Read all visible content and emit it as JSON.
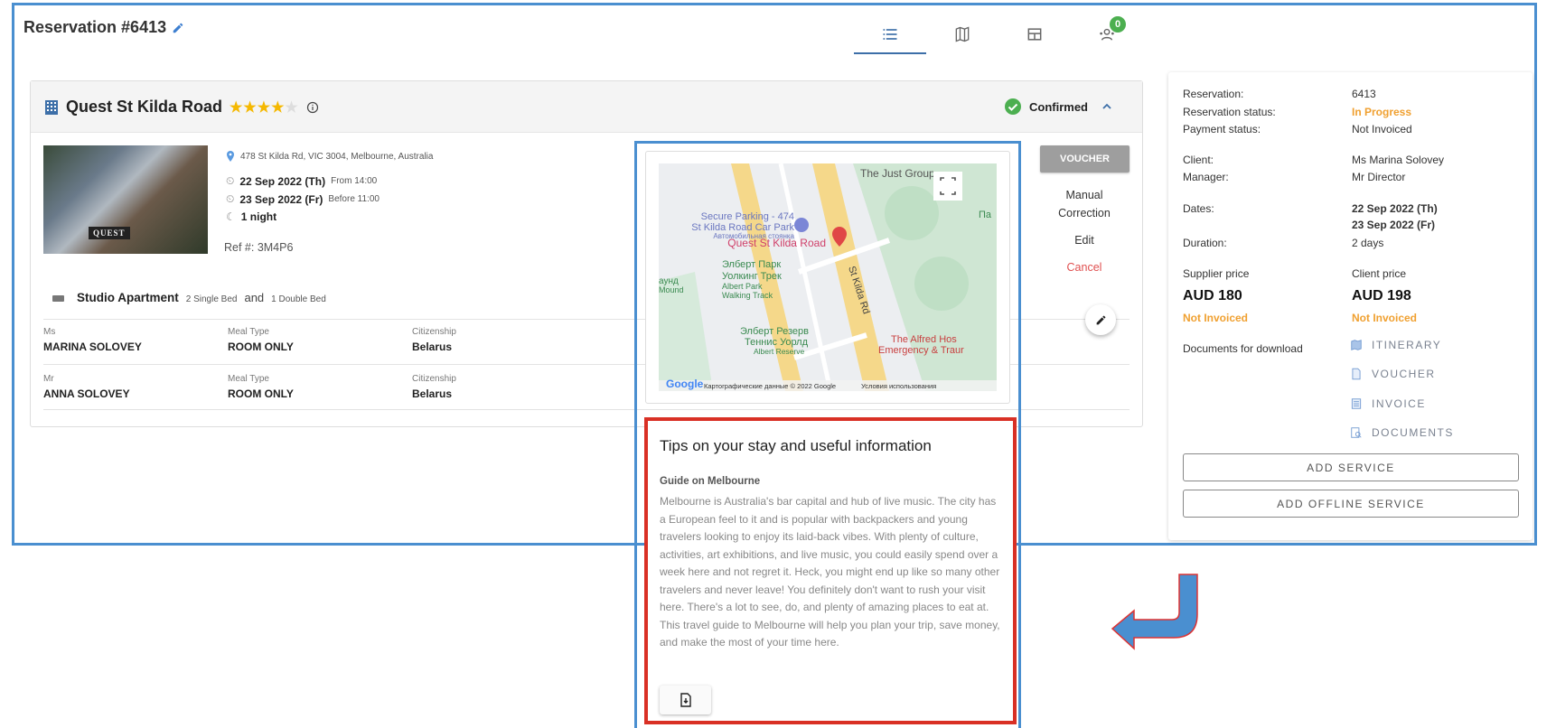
{
  "header": {
    "title": "Reservation #6413",
    "tabs": [
      {
        "icon": "list-icon",
        "active": true
      },
      {
        "icon": "map-icon"
      },
      {
        "icon": "table-icon"
      },
      {
        "icon": "group-icon",
        "badge": "0"
      }
    ]
  },
  "hotel": {
    "name": "Quest St Kilda Road",
    "stars": 4,
    "max_stars": 5,
    "status": "Confirmed",
    "address": "478 St Kilda Rd, VIC 3004, Melbourne, Australia",
    "checkin_date": "22 Sep 2022 (Th)",
    "checkin_time": "From 14:00",
    "checkout_date": "23 Sep 2022 (Fr)",
    "checkout_time": "Before 11:00",
    "nights": "1 night",
    "ref": "Ref #: 3M4P6",
    "photo_sign": "QUEST",
    "room": {
      "name": "Studio Apartment",
      "bed1": "2 Single Bed",
      "and": "and",
      "bed2": "1 Double Bed"
    },
    "guests": [
      {
        "title": "Ms",
        "name": "MARINA SOLOVEY",
        "meal_label": "Meal Type",
        "meal": "ROOM ONLY",
        "cit_label": "Citizenship",
        "citizenship": "Belarus"
      },
      {
        "title": "Mr",
        "name": "ANNA SOLOVEY",
        "meal_label": "Meal Type",
        "meal": "ROOM ONLY",
        "cit_label": "Citizenship",
        "citizenship": "Belarus"
      }
    ],
    "actions": {
      "voucher": "VOUCHER",
      "manual": "Manual Correction",
      "edit": "Edit",
      "cancel": "Cancel"
    }
  },
  "map": {
    "labels": {
      "just": "The Just Group",
      "park1": "Secure Parking - 474",
      "park2": "St Kilda Road Car Park",
      "park3": "Автомобильная стоянка",
      "quest": "Quest St Kilda Road",
      "road": "St Kilda Rd",
      "walk1": "Элберт Парк",
      "walk2": "Уолкинг Трек",
      "walk3": "Albert Park",
      "walk4": "Walking Track",
      "ten1": "Элберт Резерв",
      "ten2": "Теннис Уорлд",
      "ten3": "Albert Reserve",
      "hosp1": "The Alfred Hos",
      "hosp2": "Emergency & Traur",
      "left1": "аунд",
      "left2": "Mound",
      "right1": "Па"
    },
    "footer": "Картографические данные © 2022 Google",
    "terms": "Условия использования",
    "google": "Google"
  },
  "tips": {
    "title": "Tips on your stay and useful information",
    "subtitle": "Guide on Melbourne",
    "text": "Melbourne is Australia's bar capital and hub of live music. The city has a European feel to it and is popular with backpackers and young travelers looking to enjoy its laid-back vibes. With plenty of culture, activities, art exhibitions, and live music, you could easily spend over a week here and not regret it. Heck, you might end up like so many other travelers and never leave! You definitely don't want to rush your visit here. There's a lot to see, do, and plenty of amazing places to eat at. This travel guide to Melbourne will help you plan your trip, save money, and make the most of your time here."
  },
  "summary": {
    "reservation_label": "Reservation:",
    "reservation": "6413",
    "status_label": "Reservation status:",
    "status": "In Progress",
    "payment_label": "Payment status:",
    "payment": "Not Invoiced",
    "client_label": "Client:",
    "client": "Ms Marina Solovey",
    "manager_label": "Manager:",
    "manager": "Mr Director",
    "dates_label": "Dates:",
    "date1": "22 Sep 2022 (Th)",
    "date2": "23 Sep 2022 (Fr)",
    "duration_label": "Duration:",
    "duration": "2 days",
    "supplier_label": "Supplier price",
    "supplier_price": "AUD 180",
    "supplier_status": "Not Invoiced",
    "client_price_label": "Client price",
    "client_price": "AUD 198",
    "client_status": "Not Invoiced",
    "docs_label": "Documents for download",
    "docs": [
      "ITINERARY",
      "VOUCHER",
      "INVOICE",
      "DOCUMENTS"
    ],
    "add_service": "ADD SERVICE",
    "add_offline": "ADD OFFLINE SERVICE"
  },
  "colors": {
    "accent": "#3d6fa8",
    "highlight_blue": "#4a8fd0",
    "highlight_red": "#d93025",
    "orange": "#f0a030",
    "confirmed": "#4caf50"
  }
}
